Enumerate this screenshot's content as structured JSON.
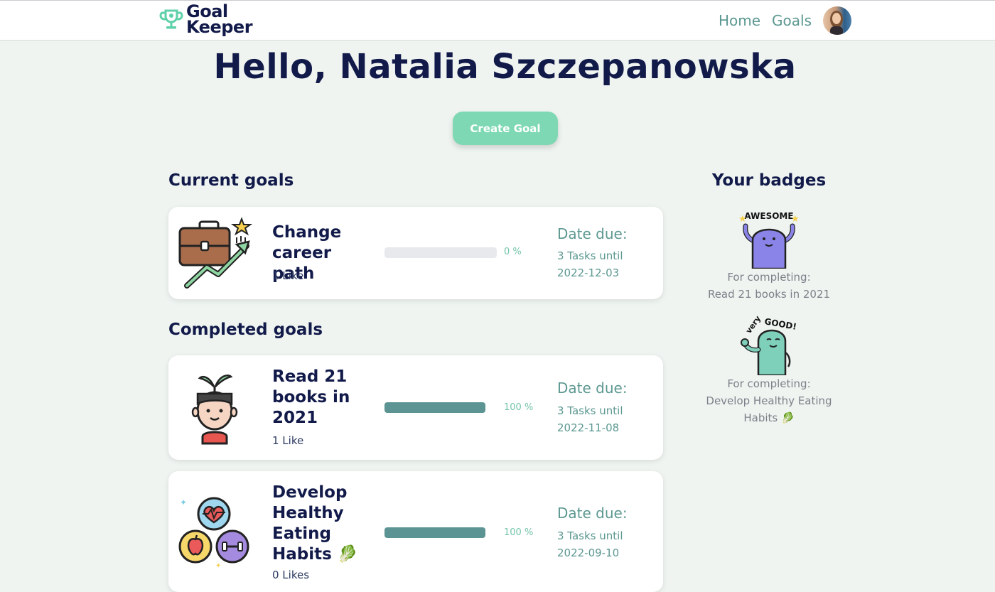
{
  "header": {
    "brand_line1": "Goal",
    "brand_line2": "Keeper",
    "nav": [
      {
        "label": "Home"
      },
      {
        "label": "Goals"
      }
    ]
  },
  "greeting": "Hello, Natalia Szczepanowska",
  "create_button": "Create Goal",
  "current_goals": {
    "title": "Current goals",
    "items": [
      {
        "title": "Change career path",
        "likes": "1 Like",
        "progress": 0,
        "progress_label": "0 %",
        "due_label": "Date due:",
        "due_value": "3 Tasks until 2022-12-03",
        "icon": "briefcase-growth-icon"
      }
    ]
  },
  "completed_goals": {
    "title": "Completed goals",
    "items": [
      {
        "title": "Read 21 books in 2021",
        "likes": "1 Like",
        "progress": 100,
        "progress_label": "100 %",
        "due_label": "Date due:",
        "due_value": "3 Tasks until 2022-11-08",
        "icon": "growing-mind-icon"
      },
      {
        "title": "Develop Healthy Eating Habits 🥬",
        "likes": "0 Likes",
        "progress": 100,
        "progress_label": "100 %",
        "due_label": "Date due:",
        "due_value": "3 Tasks until 2022-09-10",
        "icon": "health-fitness-icon"
      }
    ]
  },
  "badges": {
    "title": "Your badges",
    "items": [
      {
        "art_text": "AWESOME",
        "caption1": "For completing:",
        "caption2": "Read 21 books in 2021",
        "color": "#8b84e8"
      },
      {
        "art_text": "very GOOD!",
        "caption1": "For completing:",
        "caption2": "Develop Healthy Eating Habits 🥬",
        "color": "#7ed0bb"
      }
    ]
  },
  "colors": {
    "background": "#eff4f1",
    "navy": "#121a4a",
    "teal": "#5c9891",
    "mint": "#7dd8b3",
    "progress_fill": "#5b9492"
  }
}
